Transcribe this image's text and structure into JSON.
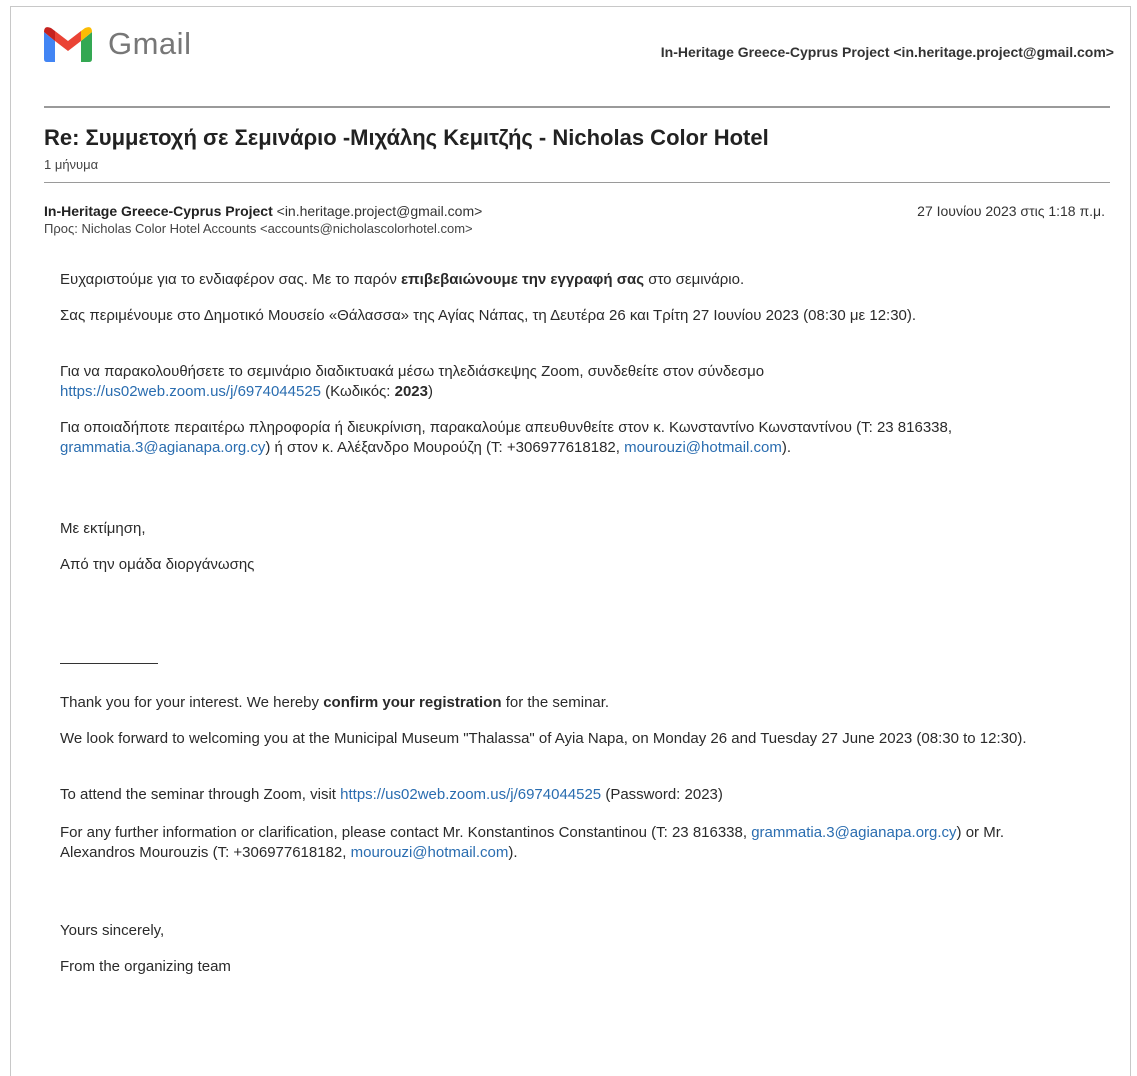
{
  "header": {
    "logo_text": "Gmail",
    "account": "In-Heritage Greece-Cyprus Project <in.heritage.project@gmail.com>"
  },
  "email": {
    "subject": "Re: Συμμετοχή σε Σεμινάριο -Μιχάλης Κεμιτζής - Nicholas Color Hotel",
    "message_count": "1 μήνυμα",
    "from_name": "In-Heritage Greece-Cyprus Project",
    "from_address": "<in.heritage.project@gmail.com>",
    "to": "Προς: Nicholas Color Hotel Accounts <accounts@nicholascolorhotel.com>",
    "date": "27 Ιουνίου 2023 στις 1:18 π.μ."
  },
  "greek": {
    "p1_pre": "Ευχαριστούμε για το ενδιαφέρον σας. Με το παρόν ",
    "p1_bold": "επιβεβαιώνουμε την εγγραφή σας",
    "p1_post": " στο σεμινάριο.",
    "p2": "Σας περιμένουμε στο Δημοτικό Μουσείο «Θάλασσα» της Αγίας Νάπας, τη Δευτέρα 26 και Τρίτη 27 Ιουνίου 2023 (08:30 με 12:30).",
    "p3_pre": "Για να παρακολουθήσετε το σεμινάριο διαδικτυακά μέσω τηλεδιάσκεψης Zoom, συνδεθείτε στον σύνδεσμο ",
    "p3_link": "https://us02web.zoom.us/j/6974044525",
    "p3_mid": " (Κωδικός: ",
    "p3_code": "2023",
    "p3_post": ")",
    "p4_pre": "Για οποιαδήποτε περαιτέρω πληροφορία ή διευκρίνιση, παρακαλούμε απευθυνθείτε στον κ. Κωνσταντίνο Κωνσταντίνου (Τ: 23 816338, ",
    "p4_email1": "grammatia.3@agianapa.org.cy",
    "p4_mid": ") ή στον κ. Αλέξανδρο Μουρούζη (Τ: +306977618182, ",
    "p4_email2": "mourouzi@hotmail.com",
    "p4_post": ").",
    "closing1": "Με εκτίμηση,",
    "closing2": "Από την ομάδα διοργάνωσης"
  },
  "english": {
    "p1_pre": "Thank you for your interest. We hereby ",
    "p1_bold": "confirm your registration",
    "p1_post": " for the seminar.",
    "p2": "We look forward to welcoming you at the Municipal Museum \"Thalassa\" of Ayia Napa, on Monday 26 and Tuesday 27 June 2023 (08:30 to 12:30).",
    "p3_pre": "To attend the seminar through Zoom, visit ",
    "p3_link": "https://us02web.zoom.us/j/6974044525",
    "p3_post": " (Password: 2023)",
    "p4_pre": "For any further information or clarification, please contact Mr. Konstantinos Constantinou (T: 23 816338, ",
    "p4_email1": "grammatia.3@agianapa.org.cy",
    "p4_mid": ") or Mr. Alexandros Mourouzis (T: +306977618182, ",
    "p4_email2": "mourouzi@hotmail.com",
    "p4_post": ").",
    "closing1": "Yours sincerely,",
    "closing2": "From the organizing team"
  }
}
